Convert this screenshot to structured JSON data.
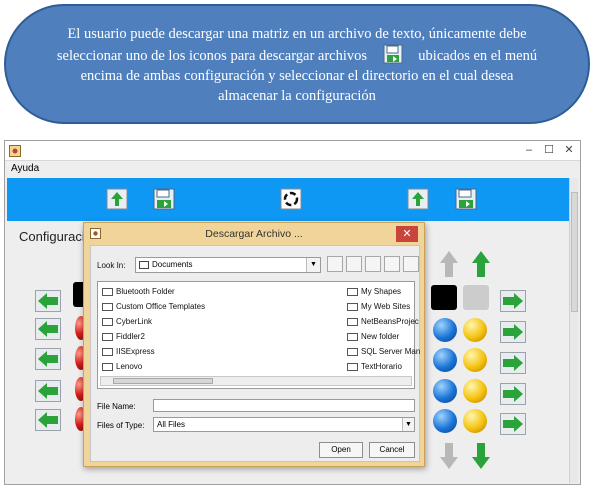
{
  "callout": {
    "text_before_icon": "El usuario puede descargar una matriz en un archivo de texto, únicamente debe seleccionar uno de los iconos para descargar archivos",
    "text_after_icon": "ubicados en el menú encima de ambas configuración y seleccionar el directorio en el cual desea almacenar la configuración",
    "icon": "save-disk-icon"
  },
  "app": {
    "menu": {
      "help_label": "Ayuda"
    },
    "window_controls": {
      "minimize": "–",
      "maximize": "☐",
      "close": "✕"
    },
    "toolbar_icons": [
      "upload-icon",
      "save-disk-icon",
      "reset-icon",
      "upload-icon",
      "save-disk-icon"
    ],
    "config_title": "Configuraci",
    "colors": {
      "toolbar": "#0f97f4",
      "arrow_green": "#2aa33a"
    }
  },
  "dialog": {
    "title": "Descargar Archivo ...",
    "close_label": "✕",
    "look_in_label": "Look In:",
    "look_in_value": "Documents",
    "files_col1": [
      "Bluetooth Folder",
      "Custom Office Templates",
      "CyberLink",
      "Fiddler2",
      "IISExpress",
      "Lenovo"
    ],
    "files_col2": [
      "My Shapes",
      "My Web Sites",
      "NetBeansProjec",
      "New folder",
      "SQL Server Man",
      "TextHorario"
    ],
    "file_name_label": "File Name:",
    "file_name_value": "",
    "file_type_label": "Files of Type:",
    "file_type_value": "All Files",
    "open_label": "Open",
    "cancel_label": "Cancel"
  }
}
